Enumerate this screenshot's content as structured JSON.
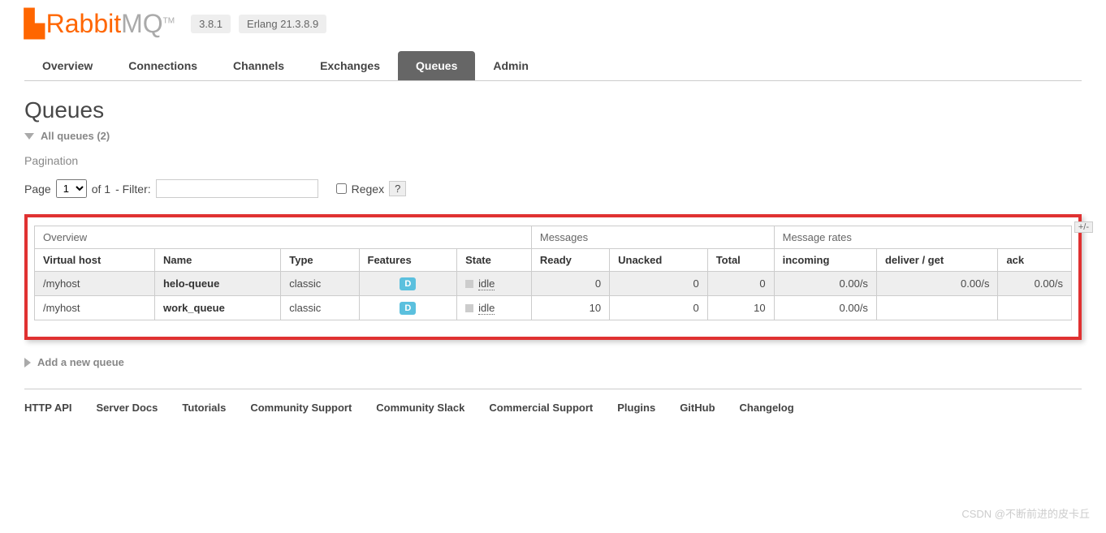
{
  "header": {
    "logo_rabbit": "Rabbit",
    "logo_mq": "MQ",
    "tm": "TM",
    "version": "3.8.1",
    "erlang": "Erlang 21.3.8.9"
  },
  "tabs": {
    "overview": "Overview",
    "connections": "Connections",
    "channels": "Channels",
    "exchanges": "Exchanges",
    "queues": "Queues",
    "admin": "Admin"
  },
  "page": {
    "title": "Queues",
    "all_queues": "All queues (2)",
    "pagination_label": "Pagination",
    "page_label": "Page",
    "page_select": "1",
    "of_label": "of 1",
    "filter_label": "- Filter:",
    "filter_value": "",
    "regex_label": "Regex",
    "help": "?",
    "plusminus": "+/-",
    "add_queue": "Add a new queue"
  },
  "table": {
    "groups": {
      "overview": "Overview",
      "messages": "Messages",
      "rates": "Message rates"
    },
    "cols": {
      "vhost": "Virtual host",
      "name": "Name",
      "type": "Type",
      "features": "Features",
      "state": "State",
      "ready": "Ready",
      "unacked": "Unacked",
      "total": "Total",
      "incoming": "incoming",
      "deliver": "deliver / get",
      "ack": "ack"
    },
    "rows": [
      {
        "vhost": "/myhost",
        "name": "helo-queue",
        "type": "classic",
        "feature": "D",
        "state": "idle",
        "ready": "0",
        "unacked": "0",
        "total": "0",
        "incoming": "0.00/s",
        "deliver": "0.00/s",
        "ack": "0.00/s"
      },
      {
        "vhost": "/myhost",
        "name": "work_queue",
        "type": "classic",
        "feature": "D",
        "state": "idle",
        "ready": "10",
        "unacked": "0",
        "total": "10",
        "incoming": "0.00/s",
        "deliver": "",
        "ack": ""
      }
    ]
  },
  "footer": {
    "http_api": "HTTP API",
    "server_docs": "Server Docs",
    "tutorials": "Tutorials",
    "community_support": "Community Support",
    "community_slack": "Community Slack",
    "commercial_support": "Commercial Support",
    "plugins": "Plugins",
    "github": "GitHub",
    "changelog": "Changelog"
  },
  "watermark": "CSDN @不断前进的皮卡丘"
}
